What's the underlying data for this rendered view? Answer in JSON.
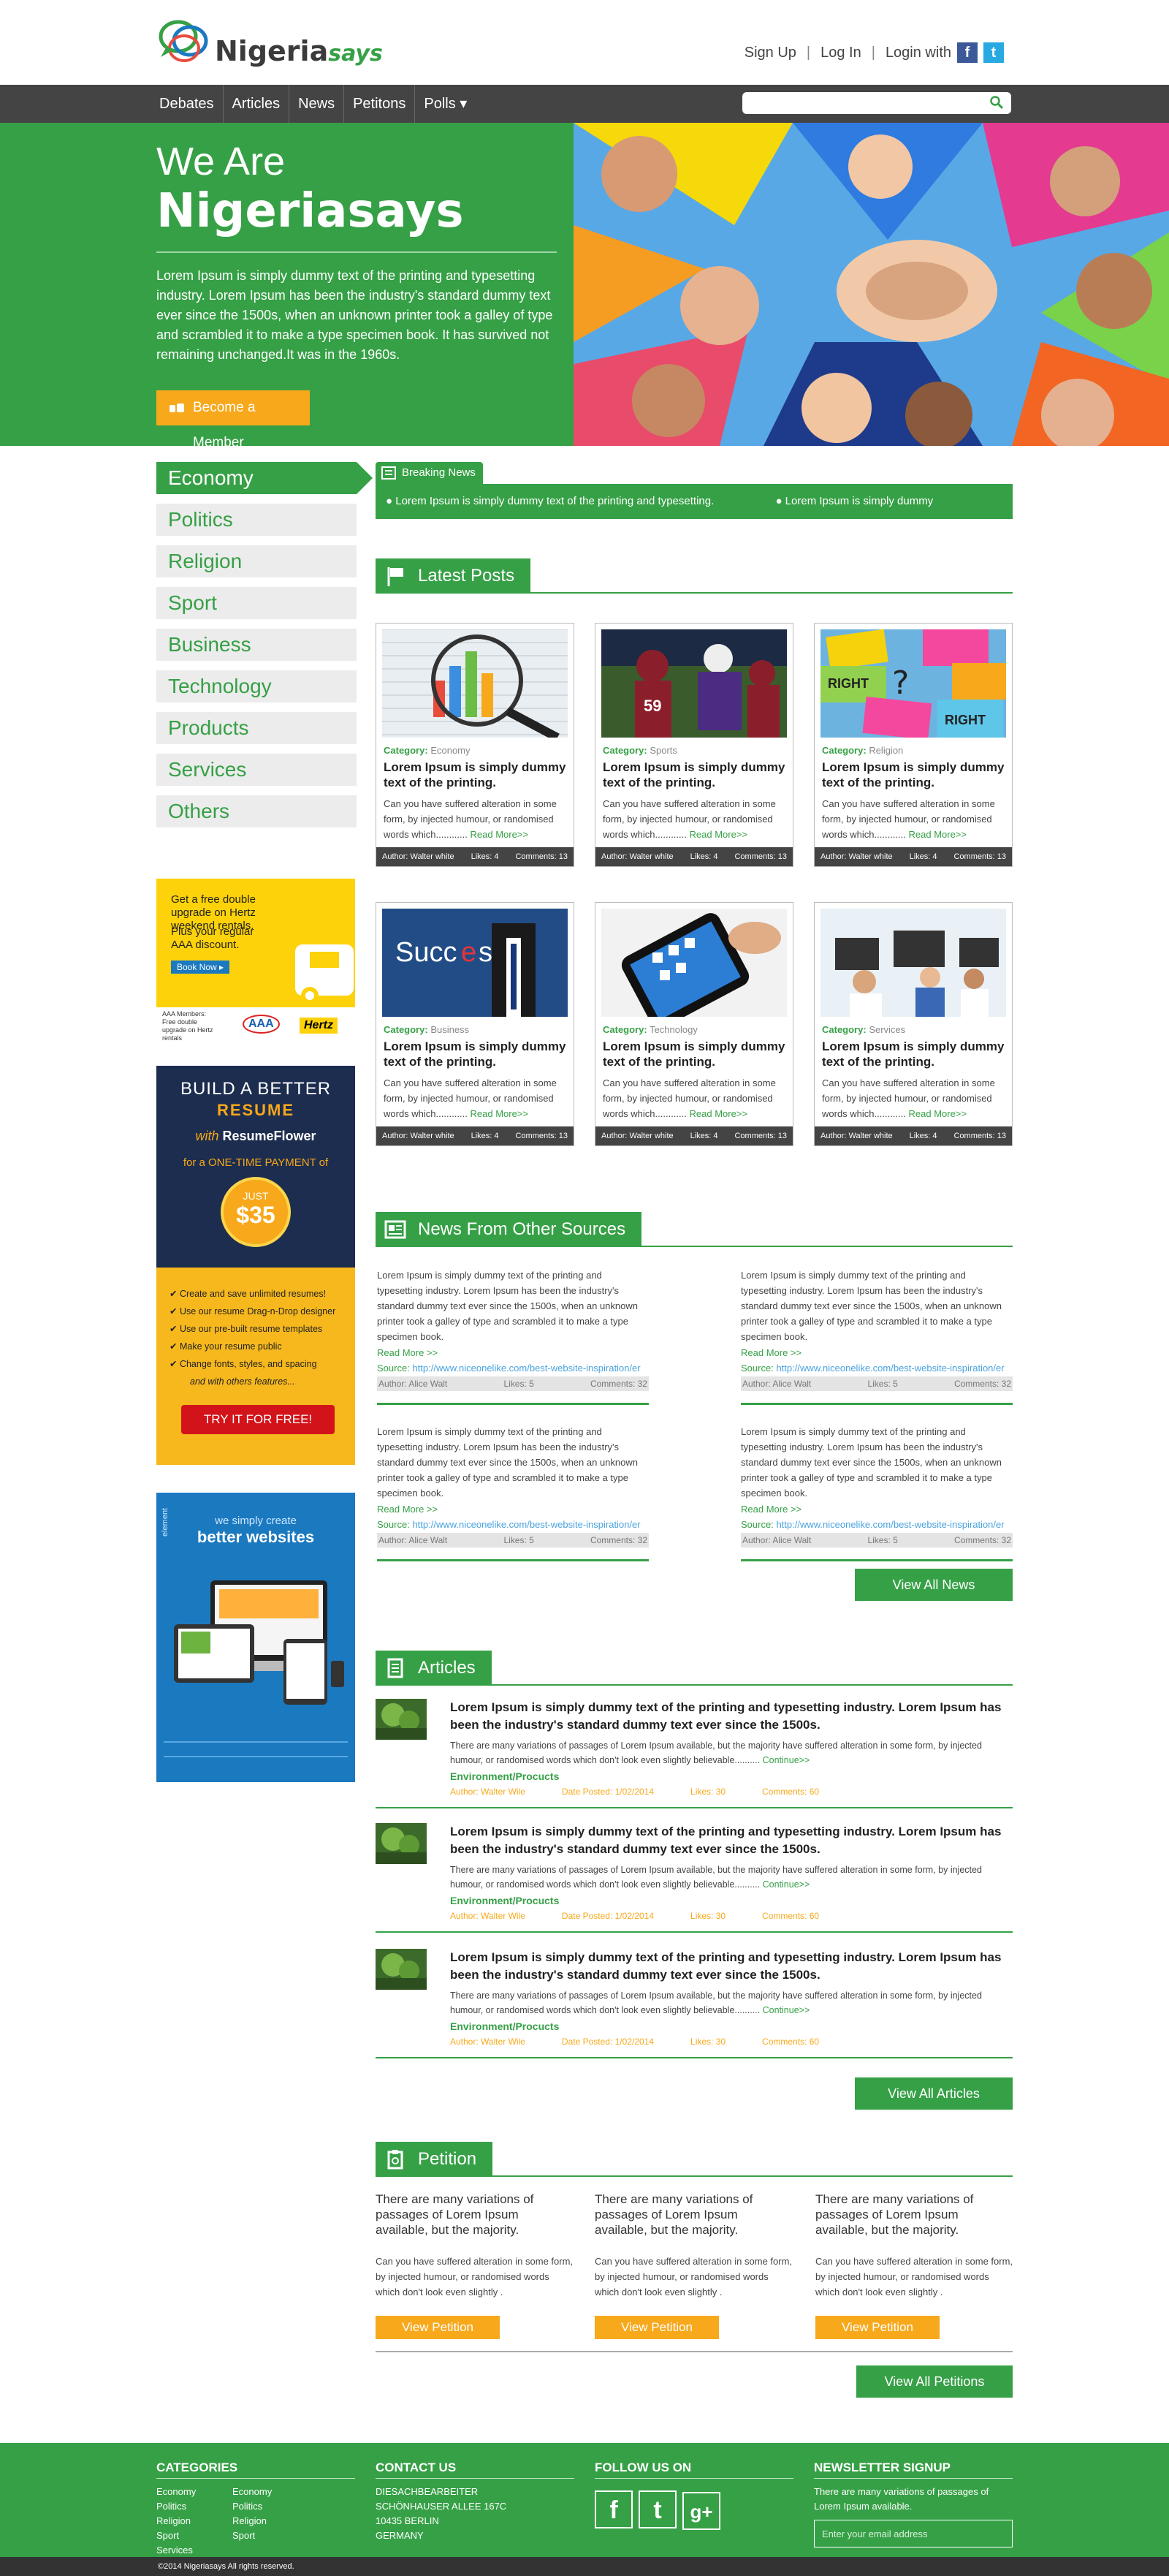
{
  "brand": {
    "name_main": "Nigeria",
    "name_accent": "says",
    "green": "#36a046",
    "orange": "#f7a81b",
    "dark": "#444444"
  },
  "topnav": {
    "signup": "Sign Up",
    "login": "Log In",
    "login_with": "Login with",
    "facebook": "f",
    "twitter": "t"
  },
  "menu": {
    "items": [
      "Debates",
      "Articles",
      "News",
      "Petitons",
      "Polls"
    ],
    "search_placeholder": ""
  },
  "hero": {
    "line1": "We Are",
    "line2": "Nigeriasays",
    "text": "Lorem Ipsum is simply dummy text of the printing and typesetting industry. Lorem Ipsum has been the industry's standard dummy text ever since the 1500s, when an unknown printer took a galley of type and scrambled it to make a type specimen book. It has survived not remaining unchanged.It was in the 1960s.",
    "button": "Become a Member"
  },
  "categories": [
    "Economy",
    "Politics",
    "Religion",
    "Sport",
    "Business",
    "Technology",
    "Products",
    "Services",
    "Others"
  ],
  "breaking": {
    "label": "Breaking News",
    "items": [
      "Lorem Ipsum is simply dummy text of the printing and typesetting.",
      "Lorem Ipsum is simply dummy text."
    ]
  },
  "latest": {
    "title": "Latest Posts",
    "category_label": "Category:",
    "read_more": "Read More>>",
    "posts": [
      {
        "category": "Economy",
        "title": "Lorem Ipsum is simply dummy text of the printing.",
        "desc": "Can you have suffered alteration in some form, by injected humour, or randomised words which............",
        "author": "Author: Walter white",
        "likes": "Likes: 4",
        "comments": "Comments: 13"
      },
      {
        "category": "Sports",
        "title": "Lorem Ipsum is simply dummy text of the printing.",
        "desc": "Can you have suffered alteration in some form, by injected humour, or randomised words which............",
        "author": "Author: Walter white",
        "likes": "Likes: 4",
        "comments": "Comments: 13"
      },
      {
        "category": "Religion",
        "title": "Lorem Ipsum is simply dummy text of the printing.",
        "desc": "Can you have suffered alteration in some form, by injected humour, or randomised words which............",
        "author": "Author: Walter white",
        "likes": "Likes: 4",
        "comments": "Comments: 13"
      },
      {
        "category": "Business",
        "title": "Lorem Ipsum is simply dummy text of the printing.",
        "desc": "Can you have suffered alteration in some form, by injected humour, or randomised words which............",
        "author": "Author: Walter white",
        "likes": "Likes: 4",
        "comments": "Comments: 13"
      },
      {
        "category": "Technology",
        "title": "Lorem Ipsum is simply dummy text of the printing.",
        "desc": "Can you have suffered alteration in some form, by injected humour, or randomised words which............",
        "author": "Author: Walter white",
        "likes": "Likes: 4",
        "comments": "Comments: 13"
      },
      {
        "category": "Services",
        "title": "Lorem Ipsum is simply dummy text of the printing.",
        "desc": "Can you have suffered alteration in some form, by injected humour, or randomised words which............",
        "author": "Author: Walter white",
        "likes": "Likes: 4",
        "comments": "Comments: 13"
      }
    ]
  },
  "news": {
    "title": "News From Other Sources",
    "text": "Lorem Ipsum is simply dummy text of the printing and typesetting industry. Lorem Ipsum has been the industry's standard dummy text ever since the 1500s, when an unknown printer took a galley of type and scrambled it to make a type specimen book.",
    "read_more": "Read More >>",
    "source_label": "Source:",
    "source_url": "http://www.niceonelike.com/best-website-inspiration/er",
    "author": "Author: Alice Walt",
    "likes": "Likes: 5",
    "comments": "Comments: 32",
    "view_all": "View All News"
  },
  "articles": {
    "title": "Articles",
    "items": [
      {
        "title": "Lorem Ipsum is simply dummy text of the printing and typesetting industry. Lorem Ipsum has been the industry's standard dummy text ever since the 1500s.",
        "desc": "There are many variations of passages of Lorem Ipsum available, but the majority have suffered alteration in some form, by injected humour, or randomised words which don't look even slightly believable..........",
        "cont": "Continue>>",
        "tag": "Environment/Procucts",
        "author": "Author: Walter Wile",
        "date": "Date Posted: 1/02/2014",
        "likes": "Likes: 30",
        "comments": "Comments: 60"
      },
      {
        "title": "Lorem Ipsum is simply dummy text of the printing and typesetting industry. Lorem Ipsum has been the industry's standard dummy text ever since the 1500s.",
        "desc": "There are many variations of passages of Lorem Ipsum available, but the majority have suffered alteration in some form, by injected humour, or randomised words which don't look even slightly believable..........",
        "cont": "Continue>>",
        "tag": "Environment/Procucts",
        "author": "Author: Walter Wile",
        "date": "Date Posted: 1/02/2014",
        "likes": "Likes: 30",
        "comments": "Comments: 60"
      },
      {
        "title": "Lorem Ipsum is simply dummy text of the printing and typesetting industry. Lorem Ipsum has been the industry's standard dummy text ever since the 1500s.",
        "desc": "There are many variations of passages of Lorem Ipsum available, but the majority have suffered alteration in some form, by injected humour, or randomised words which don't look even slightly believable..........",
        "cont": "Continue>>",
        "tag": "Environment/Procucts",
        "author": "Author: Walter Wile",
        "date": "Date Posted: 1/02/2014",
        "likes": "Likes: 30",
        "comments": "Comments: 60"
      }
    ],
    "view_all": "View All Articles"
  },
  "petition": {
    "title": "Petition",
    "heading": "There are many variations of passages of Lorem Ipsum available, but the majority.",
    "desc": "Can you have suffered alteration in some form, by injected humour, or randomised words which don't look even slightly .",
    "button": "View Petition",
    "view_all": "View All Petitions"
  },
  "ads": {
    "hertz": {
      "l1": "Get a free double upgrade on Hertz weekend rentals.",
      "l2": "Plus your regular AAA discount.",
      "btn": "Book Now",
      "small": "AAA Members: Free double upgrade on Hertz rentals",
      "brand1": "AAA",
      "brand2": "Hertz"
    },
    "resume": {
      "l1": "BUILD A BETTER",
      "l2": "RESUME",
      "with": "with",
      "brand": "ResumeFlower",
      "for": "for a ONE-TIME PAYMENT of",
      "just": "JUST",
      "price": "$35",
      "bullets": [
        "Create and save unlimited resumes!",
        "Use our resume Drag-n-Drop designer",
        "Use our pre-built resume templates",
        "Make your resume public",
        "Change fonts, styles, and spacing"
      ],
      "more": "and with others features...",
      "cta": "TRY IT FOR FREE!"
    },
    "element": {
      "brand": "element",
      "l1": "we simply create",
      "l2": "better websites"
    }
  },
  "footer": {
    "cat_title": "CATEGORIES",
    "cat_col1": [
      "Economy",
      "Politics",
      "Religion",
      "Sport",
      "Services"
    ],
    "cat_col2": [
      "Economy",
      "Politics",
      "Religion",
      "Sport"
    ],
    "contact_title": "CONTACT US",
    "contact": [
      "DIESACHBEARBEITER",
      "SCHÖNHAUSER ALLEE 167C",
      "10435 BERLIN",
      "GERMANY"
    ],
    "follow_title": "FOLLOW US ON",
    "social": [
      "f",
      "t",
      "g+"
    ],
    "news_title": "NEWSLETTER SIGNUP",
    "news_text": "There are many variations of passages of Lorem Ipsum available.",
    "news_placeholder": "Enter your email address",
    "copyright": "©2014 Nigeriasays All rights reserved."
  }
}
